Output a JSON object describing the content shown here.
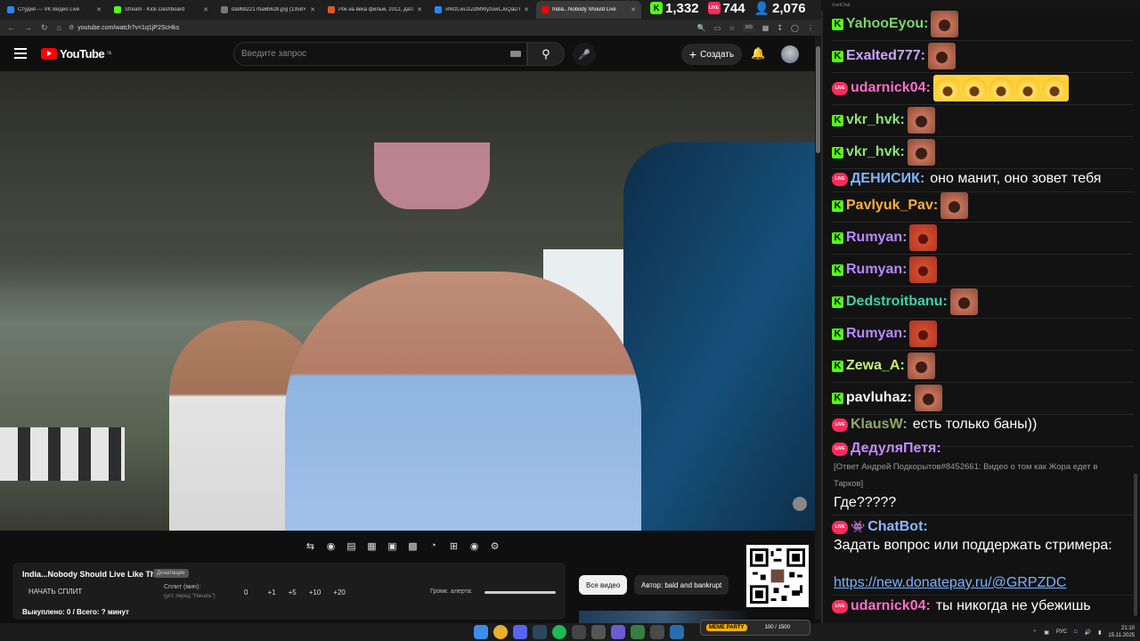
{
  "browser": {
    "tabs": [
      {
        "label": "Студия — VK Видео Live",
        "color": "#2787f5"
      },
      {
        "label": "Stream - Kick Dashboard",
        "color": "#53fc18"
      },
      {
        "label": "da9bb2217ba6b628.jpg (1358×",
        "color": "#777777"
      },
      {
        "label": "Рок на века фильм, 2012, дата",
        "color": "#e0592a"
      },
      {
        "label": "vlWzLwiJ2ZdMWyzuwLJuQaDT!",
        "color": "#2787f5"
      },
      {
        "label": "India...Nobody Should Live",
        "color": "#ff0000",
        "active": true
      }
    ],
    "url": "youtube.com/watch?v=1q1jP2ScHks",
    "ext_badge": "265"
  },
  "stats": {
    "kick": "1,332",
    "live": "744",
    "viewers": "2,076"
  },
  "youtube": {
    "logo": "YouTube",
    "region": "NL",
    "search_placeholder": "Введите запрос",
    "create_label": "Создать",
    "panel": {
      "title": "India...Nobody Should Live Like This",
      "tag": "Донатящие",
      "split_button": "НАЧАТЬ СПЛИТ",
      "split_label": "Сплит (мин):",
      "split_hint": "(уст. перед \"Начать\")",
      "split_values": [
        "0",
        "+1",
        "+5",
        "+10",
        "+20"
      ],
      "alert_label": "Громк. алерта:",
      "bought": "Выкуплено: 0 / Всего: ? минут"
    },
    "chips": [
      {
        "label": "Все видео",
        "active": true
      },
      {
        "label": "Автор: bald and bankrupt",
        "active": false
      }
    ]
  },
  "chat": {
    "window_title": "XsetChat",
    "messages": [
      {
        "platform": "kick",
        "user": "YahooEyou:",
        "color": "#7fd46d",
        "emote": "face"
      },
      {
        "platform": "kick",
        "user": "Exalted777:",
        "color": "#caa5ff",
        "emote": "face"
      },
      {
        "platform": "live",
        "user": "udarnick04:",
        "color": "#ff6ec7",
        "emote": "laughs"
      },
      {
        "platform": "kick",
        "user": "vkr_hvk:",
        "color": "#8ee27a",
        "emote": "face"
      },
      {
        "platform": "kick",
        "user": "vkr_hvk:",
        "color": "#8ee27a",
        "emote": "face"
      },
      {
        "platform": "live",
        "user": "ДЕНИСИК:",
        "color": "#7eb6ff",
        "text": "оно манит, оно зовет тебя"
      },
      {
        "platform": "kick",
        "user": "Pavlyuk_Pav:",
        "color": "#ffae3d",
        "emote": "face"
      },
      {
        "platform": "kick",
        "user": "Rumyan:",
        "color": "#b989ff",
        "emote": "red"
      },
      {
        "platform": "kick",
        "user": "Rumyan:",
        "color": "#b989ff",
        "emote": "red"
      },
      {
        "platform": "kick",
        "user": "Dedstroitbanu:",
        "color": "#39d5a6",
        "emote": "face"
      },
      {
        "platform": "kick",
        "user": "Rumyan:",
        "color": "#b989ff",
        "emote": "red"
      },
      {
        "platform": "kick",
        "user": "Zewa_A:",
        "color": "#c9f270",
        "emote": "face"
      },
      {
        "platform": "kick",
        "user": "pavluhaz:",
        "color": "#f5f5f5",
        "emote": "face"
      },
      {
        "platform": "live",
        "user": "KlausW:",
        "color": "#8ea86a",
        "text": "есть только баны))"
      }
    ],
    "reply_block": {
      "user": "ДедуляПетя:",
      "user_color": "#c38bff",
      "reply": "[Ответ Андрей Подкорытов#8452661: Видео о том как Жора едет в Тарков]",
      "text": "Где?????"
    },
    "bot_block": {
      "user": "ChatBot:",
      "user_color": "#8fb7ff",
      "text": "Задать вопрос или поддержать стримера:",
      "link": "https://new.donatepay.ru/@GRPZDC"
    },
    "last": {
      "platform": "live",
      "user": "udarnick04:",
      "color": "#ff6ec7",
      "text": "ты никогда не убежишь"
    }
  },
  "taskbar": {
    "meme_label": "MEME PARTY",
    "meme_value": "100 / 1500",
    "lang": "РУС",
    "time": "21:10",
    "date": "15.11.2025"
  }
}
